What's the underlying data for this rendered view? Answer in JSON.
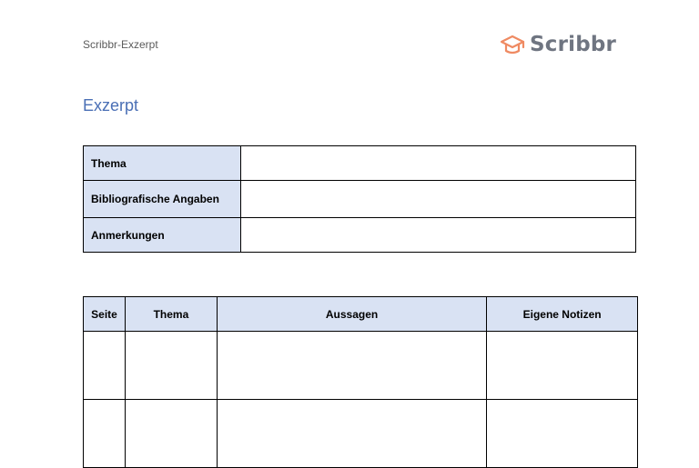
{
  "header": {
    "doc_label": "Scribbr-Exzerpt",
    "logo_text": "Scribbr",
    "logo_icon": "graduation-cap-icon",
    "accent_color": "#ef8a62"
  },
  "document": {
    "title": "Exzerpt",
    "title_color": "#4a6fb5"
  },
  "info_table": {
    "rows": [
      {
        "label": "Thema",
        "value": ""
      },
      {
        "label": "Bibliografische Angaben",
        "value": ""
      },
      {
        "label": "Anmerkungen",
        "value": ""
      }
    ]
  },
  "notes_table": {
    "headers": [
      "Seite",
      "Thema",
      "Aussagen",
      "Eigene Notizen"
    ],
    "rows": [
      [
        "",
        "",
        "",
        ""
      ],
      [
        "",
        "",
        "",
        ""
      ]
    ]
  },
  "colors": {
    "header_fill": "#d9e2f3",
    "border": "#000000"
  }
}
